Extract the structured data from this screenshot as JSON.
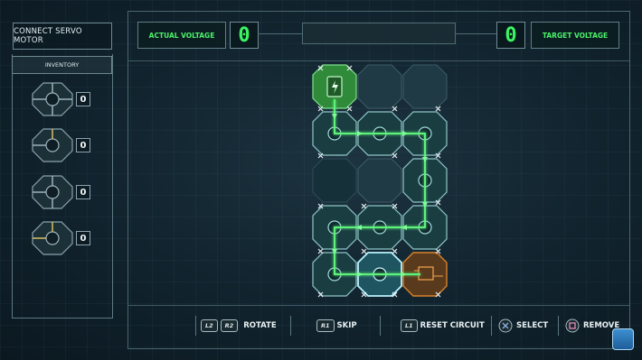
{
  "title": "CONNECT SERVO MOTOR",
  "inventory": {
    "header": "INVENTORY",
    "items": [
      {
        "piece": "cross-piece",
        "count": "0"
      },
      {
        "piece": "corner-piece",
        "count": "0"
      },
      {
        "piece": "tee-piece",
        "count": "0"
      },
      {
        "piece": "straight-piece",
        "count": "0"
      }
    ]
  },
  "voltage": {
    "actual_label": "ACTUAL VOLTAGE",
    "actual_value": "0",
    "target_label": "TARGET VOLTAGE",
    "target_value": "0"
  },
  "controls": {
    "rotate_keys": [
      "L2",
      "R2"
    ],
    "rotate_label": "ROTATE",
    "skip_key": "R1",
    "skip_label": "SKIP",
    "reset_key": "L1",
    "reset_label": "RESET CIRCUIT",
    "select_label": "SELECT",
    "remove_label": "REMOVE"
  },
  "colors": {
    "accent_green": "#3cf463",
    "panel_border": "#5f7d87",
    "circuit_line": "#5df27a",
    "source_fill": "#44c24d",
    "target_orange": "#d9822b"
  }
}
